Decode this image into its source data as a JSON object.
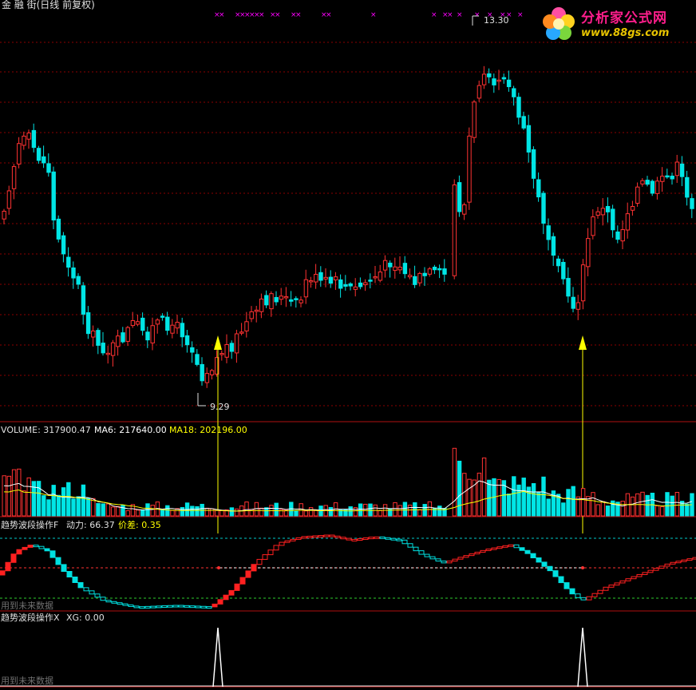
{
  "main_panel": {
    "title": "金 融 街(日线 前复权)",
    "high_marker": "13.30",
    "low_marker": "9.29",
    "cross_marks": "×"
  },
  "volume_panel": {
    "label": "VOLUME: 317900.47",
    "ma6": "MA6: 217640.00",
    "ma18": "MA18: 202196.00"
  },
  "indicator_f": {
    "name": "趋势波段操作F",
    "dongli": "动力: 66.37",
    "jiacha": "价差: 0.35",
    "future_note": "用到未来数据"
  },
  "indicator_x": {
    "name": "趋势波段操作X",
    "xg": "XG: 0.00",
    "future_note": "用到未来数据"
  },
  "watermark": {
    "name": "分析家公式网",
    "url": "www.88gs.com"
  },
  "colors": {
    "background": "#000000",
    "up": "#ff3232",
    "down": "#00e5e5",
    "grid": "#8b0000",
    "signal_arrow": "#ffff00",
    "ma6": "#ffffff",
    "ma18": "#ffff00",
    "cross": "#ff00ff"
  },
  "chart_data": {
    "type": "candlestick",
    "title": "金 融 街(日线 前复权)",
    "price_high": 13.3,
    "price_low": 9.29,
    "buy_signals": 2,
    "volume": 317900.47,
    "volume_ma6": 217640.0,
    "volume_ma18": 202196.0,
    "indicator_dongli": 66.37,
    "indicator_jiacha": 0.35,
    "indicator_xg": 0.0
  }
}
